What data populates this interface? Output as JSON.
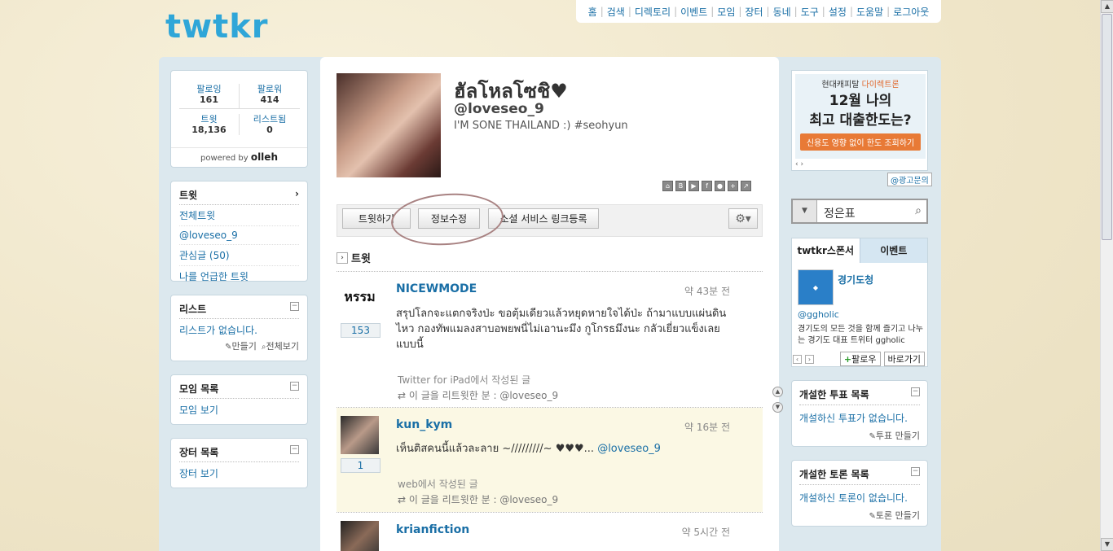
{
  "header": {
    "logo": "twtkr",
    "nav": [
      "홈",
      "검색",
      "디렉토리",
      "이벤트",
      "모임",
      "장터",
      "동네",
      "도구",
      "설정",
      "도움말",
      "로그아웃"
    ]
  },
  "stats": {
    "following_label": "팔로잉",
    "following": "161",
    "followers_label": "팔로워",
    "followers": "414",
    "tweets_label": "트윗",
    "tweets": "18,136",
    "listed_label": "리스트됨",
    "listed": "0",
    "powered": "powered by",
    "powered_brand": "olleh"
  },
  "left_menu": {
    "title": "트윗",
    "items": [
      "전체트윗",
      "@loveseo_9",
      "관심글 (50)",
      "나를 언급한 트윗"
    ]
  },
  "list_box": {
    "title": "리스트",
    "empty": "리스트가 없습니다.",
    "make": "만들기",
    "view_all": "전체보기"
  },
  "group_box": {
    "title": "모임 목록",
    "link": "모임 보기"
  },
  "market_box": {
    "title": "장터 목록",
    "link": "장터 보기"
  },
  "profile": {
    "name": "ฮัลโหลโซชิ♥",
    "handle": "@loveseo_9",
    "bio": "I'M SONE THAILAND :) #seohyun",
    "social_icons": [
      "home-icon",
      "blog-icon",
      "youtube-icon",
      "facebook-icon",
      "me2day-icon",
      "plus-icon",
      "external-icon"
    ]
  },
  "actions": {
    "tweet": "트윗하기",
    "edit": "정보수정",
    "social_link": "소셜 서비스 링크등록",
    "gear": "⚙▾"
  },
  "timeline": {
    "title": "트윗",
    "tweets": [
      {
        "user": "NICEWMODE",
        "avatar_text": "หรรม",
        "count": "153",
        "time": "약 43분 전",
        "text": "สรุปโลกจะแตกจริงป่ะ ขอตุ้มเดียวแล้วหยุดหายใจได้ป่ะ ถ้ามาแบบแผ่นดินไหว กองทัพแมลงสาบอพยพนี่ไม่เอานะมึง กูโกรธมึงนะ กลัวเยี่ยวแข็งเลยแบบนี้",
        "source": "Twitter for iPad에서 작성된 글",
        "rt": "이 글을 리트윗한 분 : @loveseo_9"
      },
      {
        "user": "kun_kym",
        "count": "1",
        "time": "약 16분 전",
        "text": "เห็นติสคนนี้แล้วละลาย ~/////////~ ♥♥♥... ",
        "mention": "@loveseo_9",
        "source": "web에서 작성된 글",
        "rt": "이 글을 리트윗한 분 : @loveseo_9"
      },
      {
        "user": "krianfiction",
        "time": "약 5시간 전"
      }
    ]
  },
  "ad": {
    "brand_left": "현대캐피탈",
    "brand_right": "다이렉트론",
    "line1": "12월 나의",
    "line2": "최고 대출한도는?",
    "cta": "신용도 영향 없이 한도 조회하기",
    "inquiry": "@광고문의"
  },
  "search": {
    "value": "정은표"
  },
  "sponsor": {
    "tab1": "twtkr스폰서",
    "tab2": "이벤트",
    "name": "경기도청",
    "handle": "@ggholic",
    "desc": "경기도의 모든 것을 함께 즐기고 나누는 경기도 대표 트위터 ggholic",
    "follow": "팔로우",
    "shortcut": "바로가기"
  },
  "poll_box": {
    "title": "개설한 투표 목록",
    "empty": "개설하신 투표가 없습니다.",
    "make": "투표 만들기"
  },
  "debate_box": {
    "title": "개설한 토론 목록",
    "empty": "개설하신 토론이 없습니다.",
    "make": "토론 만들기"
  },
  "colors": {
    "accent": "#1a6fa6",
    "logo": "#2fa6d8",
    "bg": "#f1ead2"
  }
}
